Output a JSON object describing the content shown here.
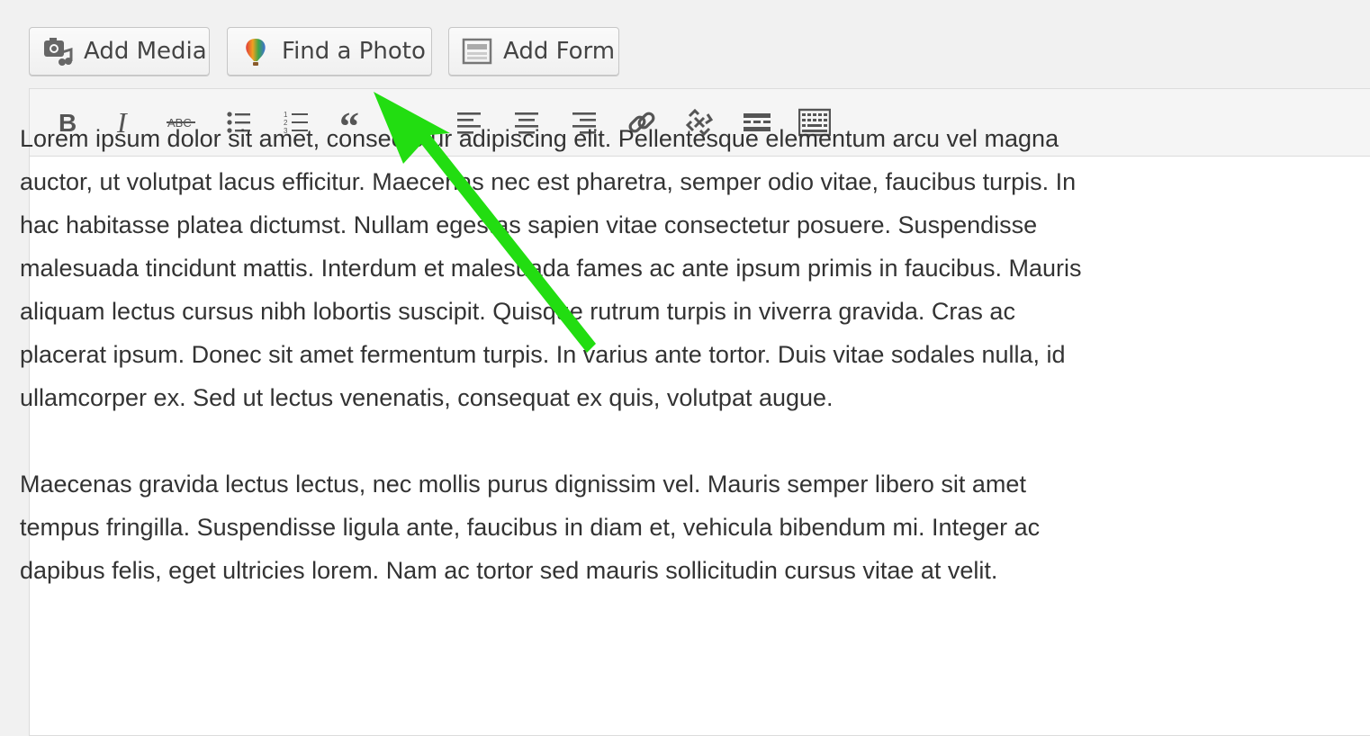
{
  "media_buttons": {
    "add_media": "Add Media",
    "find_photo": "Find a Photo",
    "add_form": "Add Form"
  },
  "toolbar": {
    "icons": [
      "bold-icon",
      "italic-icon",
      "strikethrough-icon",
      "bulleted-list-icon",
      "numbered-list-icon",
      "blockquote-icon",
      "align-left-icon",
      "align-center-icon",
      "align-right-icon",
      "insert-link-icon",
      "remove-link-icon",
      "read-more-icon",
      "toolbar-toggle-icon"
    ]
  },
  "content": {
    "paragraph1": "Lorem ipsum dolor sit amet, consectetur adipiscing elit. Pellentesque elementum arcu vel magna auctor, ut volutpat lacus efficitur. Maecenas nec est pharetra, semper odio vitae, faucibus turpis. In hac habitasse platea dictumst. Nullam egestas sapien vitae consectetur posuere. Suspendisse malesuada tincidunt mattis. Interdum et malesuada fames ac ante ipsum primis in faucibus. Mauris aliquam lectus cursus nibh lobortis suscipit. Quisque rutrum turpis in viverra gravida. Cras ac placerat ipsum. Donec sit amet fermentum turpis. In varius ante tortor. Duis vitae sodales nulla, id ullamcorper ex. Sed ut lectus venenatis, consequat ex quis, volutpat augue.",
    "paragraph2": "Maecenas gravida lectus lectus, nec mollis purus dignissim vel. Mauris semper libero sit amet tempus fringilla. Suspendisse ligula ante, faucibus in diam et, vehicula bibendum mi. Integer ac dapibus felis, eget ultricies lorem. Nam ac tortor sed mauris sollicitudin cursus vitae at velit."
  },
  "colors": {
    "annotation_arrow": "#22dd11"
  }
}
